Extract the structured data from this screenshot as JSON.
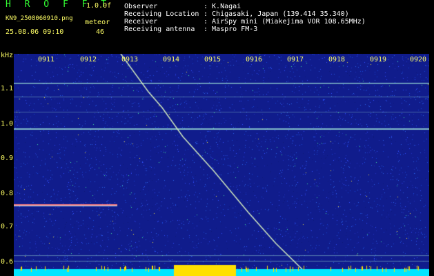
{
  "header": {
    "app_title": "H R O F F T",
    "version": "1.0.0f",
    "filename": "KN9_2508060910.png",
    "mode": "meteor",
    "datetime": "25.08.06 09:10",
    "count": "46"
  },
  "info": [
    {
      "label": "Observer",
      "value": ": K.Nagai"
    },
    {
      "label": "Receiving Location",
      "value": ": Chigasaki, Japan (139.414 35.340)"
    },
    {
      "label": "Receiver",
      "value": ": AirSpy mini (Miakejima VOR 108.65MHz)"
    },
    {
      "label": "Receiving antenna",
      "value": ": Maspro FM-3"
    }
  ],
  "plot": {
    "unit_label": "kHz",
    "y_ticks": [
      "1.1",
      "1.0",
      "0.9",
      "0.8",
      "0.7",
      "0.6"
    ],
    "x_ticks": [
      "0911",
      "0912",
      "0913",
      "0914",
      "0915",
      "0916",
      "0917",
      "0918",
      "0919",
      "0920"
    ]
  },
  "colors": {
    "background": "#000000",
    "noise_base": "#101c8c",
    "carrier_line": "#9fe6d8",
    "meteor_trace": "#d8f0c0",
    "label": "#ffff66",
    "title": "#33ff33",
    "bottom_bar": "#00e5ff"
  }
}
